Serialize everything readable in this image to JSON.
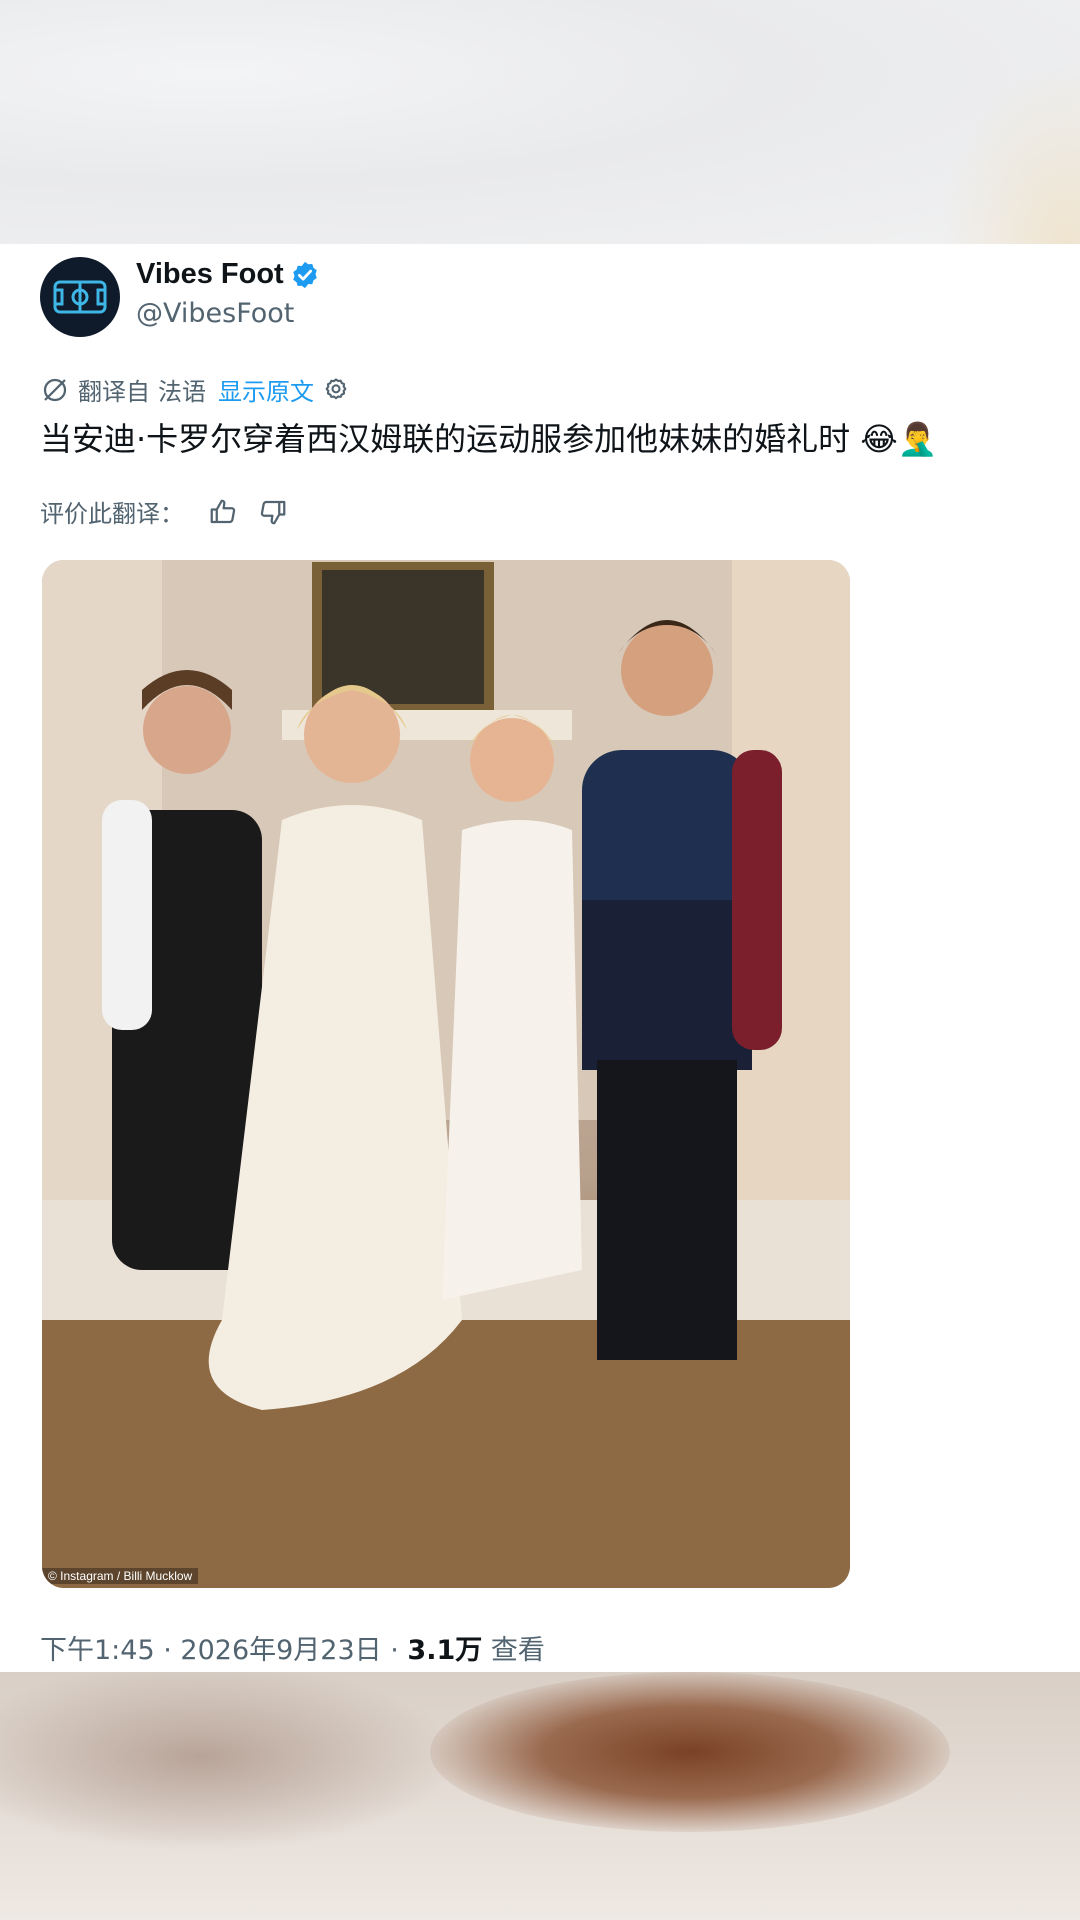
{
  "account": {
    "display_name": "Vibes Foot",
    "handle": "@VibesFoot"
  },
  "translation": {
    "prefix": "翻译自",
    "language": "法语",
    "show_original": "显示原文"
  },
  "tweet": {
    "text": "当安迪·卡罗尔穿着西汉姆联的运动服参加他妹妹的婚礼时 😂🤦‍♂️"
  },
  "rate": {
    "label": "评价此翻译："
  },
  "media": {
    "caption": "© Instagram / Billi Mucklow"
  },
  "meta": {
    "time": "下午1:45",
    "date": "2026年9月23日",
    "views_count": "3.1万",
    "views_label": "查看"
  },
  "colors": {
    "accent": "#1d9bf0",
    "text_primary": "#0f1419",
    "text_secondary": "#536471"
  },
  "icons": {
    "avatar": "soccer-pitch-logo-icon",
    "verified": "verified-badge-icon",
    "translate": "translate-icon",
    "settings": "gear-icon",
    "thumbs_up": "thumbs-up-icon",
    "thumbs_down": "thumbs-down-icon"
  }
}
